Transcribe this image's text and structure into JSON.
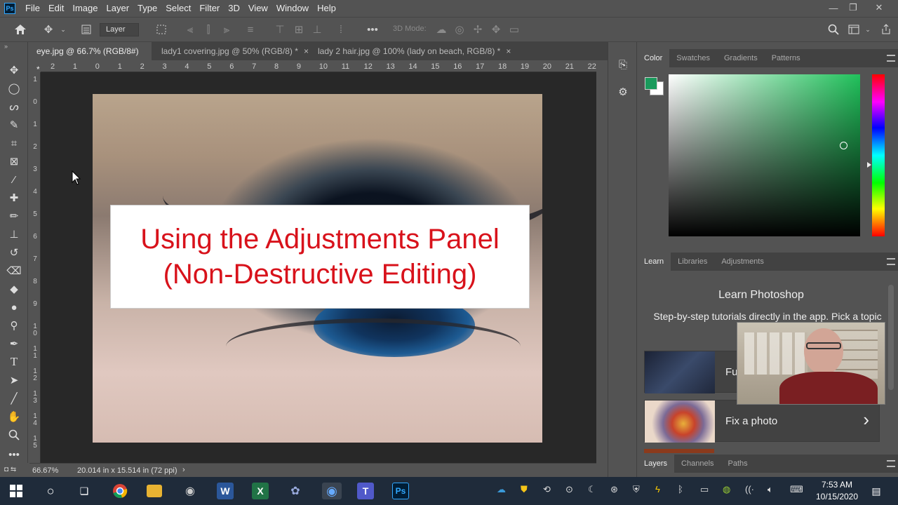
{
  "menubar": {
    "logo": "Ps",
    "items": [
      "File",
      "Edit",
      "Image",
      "Layer",
      "Type",
      "Select",
      "Filter",
      "3D",
      "View",
      "Window",
      "Help"
    ],
    "minimize": "—",
    "restore": "❐",
    "close": "✕"
  },
  "options": {
    "layer_dropdown": "Layer",
    "mode_3d": "3D Mode:"
  },
  "tabs": [
    {
      "label": "eye.jpg @ 66.7% (RGB/8#) *",
      "close": "×"
    },
    {
      "label": "lady1 covering.jpg @ 50% (RGB/8) *",
      "close": "×"
    },
    {
      "label": "lady 2 hair.jpg @ 100% (lady on beach, RGB/8) *",
      "close": "×"
    }
  ],
  "ruler_top": [
    "2",
    "1",
    "0",
    "1",
    "2",
    "3",
    "4",
    "5",
    "6",
    "7",
    "8",
    "9",
    "10",
    "11",
    "12",
    "13",
    "14",
    "15",
    "16",
    "17",
    "18",
    "19",
    "20",
    "21",
    "22"
  ],
  "ruler_left": [
    "1",
    "0",
    "1",
    "2",
    "3",
    "4",
    "5",
    "6",
    "7",
    "8",
    "9",
    "1\n0",
    "1\n1",
    "1\n2",
    "1\n3",
    "1\n4",
    "1\n5"
  ],
  "overlay": {
    "line1": "Using the Adjustments Panel",
    "line2": "(Non-Destructive Editing)"
  },
  "status": {
    "zoom": "66.67%",
    "doc_size": "20.014 in x 15.514 in (72 ppi)",
    "arrow": "›"
  },
  "color_panel": {
    "tabs": [
      "Color",
      "Swatches",
      "Gradients",
      "Patterns"
    ],
    "foreground": "#1a9a5c",
    "background": "#ffffff"
  },
  "learn_panel": {
    "tabs": [
      "Learn",
      "Libraries",
      "Adjustments"
    ],
    "heading": "Learn Photoshop",
    "subtitle": "Step-by-step tutorials directly in the app. Pick a topic",
    "tile1": "Fu",
    "tile2": "Fix a photo",
    "tile_arrow": "›"
  },
  "layers_panel": {
    "tabs": [
      "Layers",
      "Channels",
      "Paths"
    ]
  },
  "taskbar": {
    "time": "7:53 AM",
    "date": "10/15/2020",
    "apps": [
      "windows-start",
      "cortana",
      "task-view",
      "chrome",
      "file-explorer",
      "camera",
      "word",
      "excel",
      "paint",
      "obs",
      "teams",
      "photoshop"
    ]
  }
}
